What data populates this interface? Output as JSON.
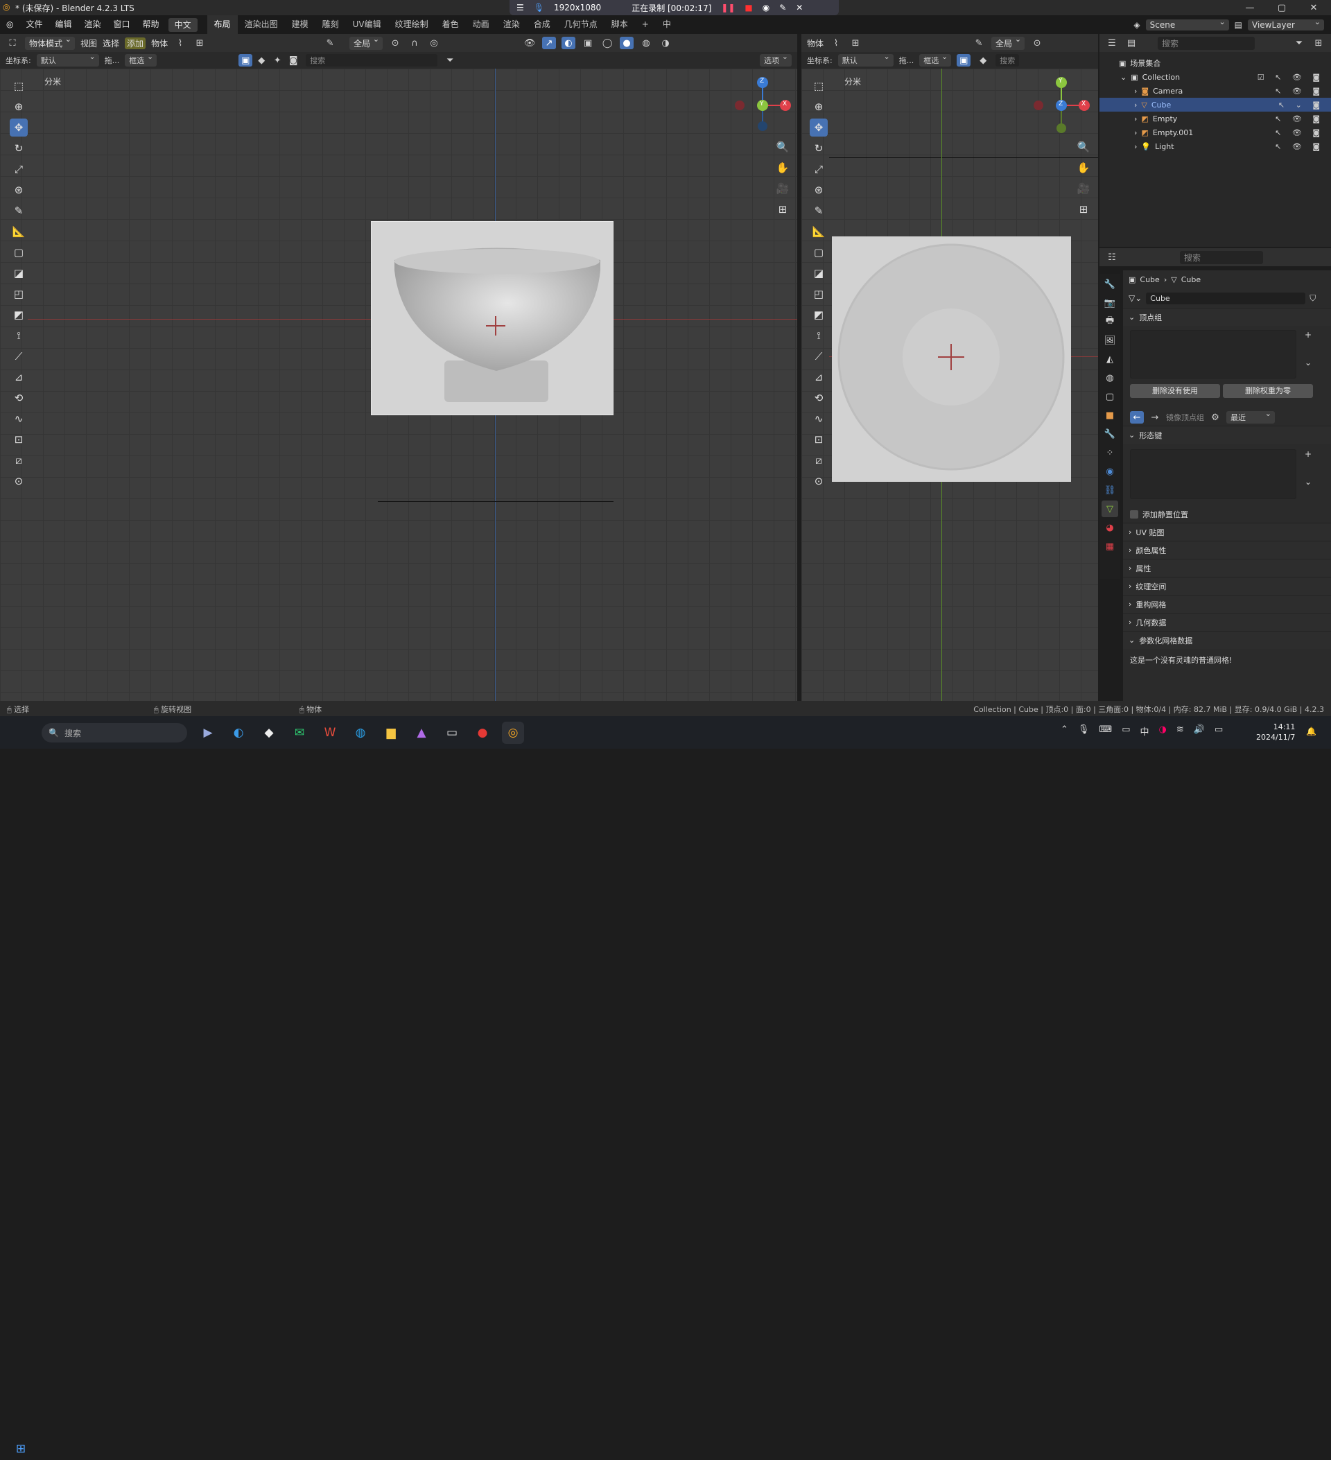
{
  "window": {
    "title": "* (未保存) - Blender 4.2.3 LTS",
    "minimize": "—",
    "maximize": "▢",
    "close": "✕"
  },
  "recorder": {
    "resolution": "1920x1080",
    "status": "正在录制 [00:02:17]"
  },
  "menu": [
    "文件",
    "编辑",
    "渲染",
    "窗口",
    "帮助"
  ],
  "language_button": "中文",
  "workspaces": [
    "布局",
    "渲染出图",
    "建模",
    "雕刻",
    "UV编辑",
    "纹理绘制",
    "着色",
    "动画",
    "渲染",
    "合成",
    "几何节点",
    "脚本"
  ],
  "active_workspace": "布局",
  "scene": "Scene",
  "view_layer": "ViewLayer",
  "left_viewport": {
    "header": {
      "mode": "物体模式",
      "menus": [
        "视图",
        "选择",
        "添加",
        "物体"
      ],
      "transform": "全局",
      "options": "选项"
    },
    "header2": {
      "orientation_label": "坐标系:",
      "orientation": "默认",
      "drag_label": "拖...",
      "drag": "框选",
      "search_placeholder": "搜索"
    },
    "unit_label": "分米"
  },
  "right_viewport": {
    "header": {
      "menu": "物体",
      "transform": "全局"
    },
    "header2": {
      "orientation_label": "坐标系:",
      "orientation": "默认",
      "drag_label": "拖...",
      "drag": "框选",
      "search_placeholder": "搜索"
    },
    "unit_label": "分米"
  },
  "gizmo": {
    "x": "X",
    "y": "Y",
    "z": "Z"
  },
  "outliner": {
    "search_placeholder": "搜索",
    "root": "场景集合",
    "collection": "Collection",
    "items": [
      {
        "name": "Camera",
        "selected": false
      },
      {
        "name": "Cube",
        "selected": true
      },
      {
        "name": "Empty",
        "selected": false
      },
      {
        "name": "Empty.001",
        "selected": false
      },
      {
        "name": "Light",
        "selected": false
      }
    ]
  },
  "properties": {
    "search_placeholder": "搜索",
    "breadcrumb": [
      "Cube",
      "Cube"
    ],
    "mesh_name": "Cube",
    "sections": {
      "vertex_groups": "顶点组",
      "remove_unused": "删除没有使用",
      "remove_zero": "删除权重为零",
      "mirror_vertex": "镜像顶点组",
      "nearest": "最近",
      "shape_keys": "形态键",
      "add_rest_position": "添加静置位置",
      "collapsed": [
        "UV 贴图",
        "颜色属性",
        "属性",
        "纹理空间",
        "重构网格",
        "几何数据",
        "参数化网格数据"
      ],
      "note": "这是一个没有灵魂的普通网格!"
    }
  },
  "status": {
    "left": [
      "选择",
      "旋转视图",
      "物体"
    ],
    "right": "Collection | Cube | 顶点:0 | 面:0 | 三角面:0 | 物体:0/4 | 内存: 82.7 MiB | 显存: 0.9/4.0 GiB | 4.2.3"
  },
  "taskbar": {
    "search_placeholder": "搜索",
    "time": "14:11",
    "date": "2024/11/7"
  },
  "colors": {
    "accent": "#4772b3",
    "x_axis": "#e0404a",
    "y_axis": "#8cc63f",
    "z_axis": "#3a7bd5"
  }
}
